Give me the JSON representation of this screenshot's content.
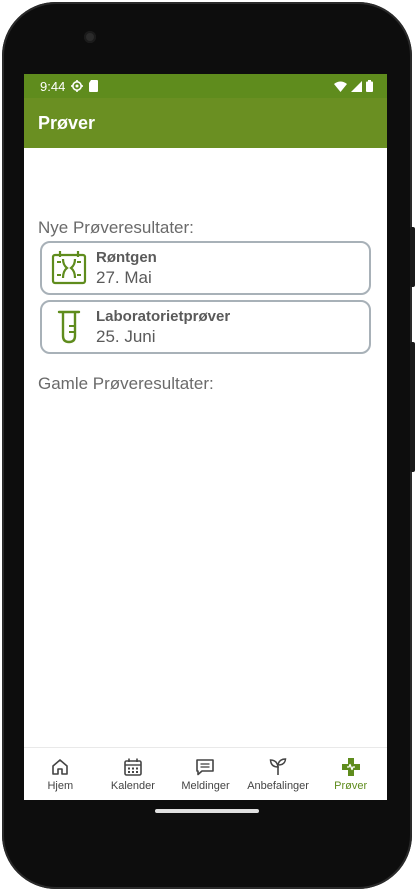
{
  "status": {
    "time": "9:44"
  },
  "appbar": {
    "title": "Prøver"
  },
  "new_results": {
    "title": "Nye Prøveresultater:",
    "items": [
      {
        "name": "Røntgen",
        "date": "27. Mai",
        "icon": "xray-icon"
      },
      {
        "name": "Laboratorietprøver",
        "date": "25. Juni",
        "icon": "test-tube-icon"
      }
    ]
  },
  "old_results": {
    "title": "Gamle Prøveresultater:"
  },
  "nav": {
    "items": [
      {
        "label": "Hjem",
        "icon": "home-icon"
      },
      {
        "label": "Kalender",
        "icon": "calendar-icon"
      },
      {
        "label": "Meldinger",
        "icon": "message-icon"
      },
      {
        "label": "Anbefalinger",
        "icon": "sprout-icon"
      },
      {
        "label": "Prøver",
        "icon": "medical-cross-icon",
        "active": true
      }
    ]
  },
  "colors": {
    "brand": "#6a8f22",
    "statusbar": "#5f8c1d",
    "card_border": "#a8b1b8"
  }
}
